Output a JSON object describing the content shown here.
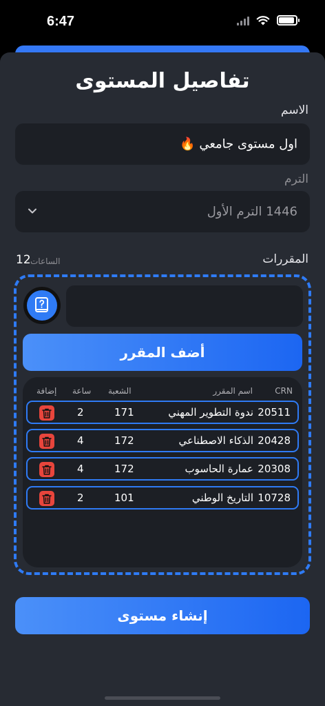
{
  "status": {
    "time": "6:47"
  },
  "title": "تفاصيل المستوى",
  "name_field": {
    "label": "الاسم",
    "value": "اول مستوى جامعي 🔥"
  },
  "term_field": {
    "label": "الترم",
    "value": "1446 الترم الأول"
  },
  "courses": {
    "label": "المقررات",
    "hours_label": "الساعات",
    "hours_value": "12",
    "input_placeholder": "",
    "add_button": "أضف المقرر",
    "columns": {
      "crn": "CRN",
      "name": "اسم المقرر",
      "section": "الشعبة",
      "hours": "ساعة",
      "action": "إضافة"
    },
    "rows": [
      {
        "crn": "20511",
        "name": "ندوة التطوير المهني",
        "section": "171",
        "hours": "2"
      },
      {
        "crn": "20428",
        "name": "الذكاء الاصطناعي",
        "section": "172",
        "hours": "4"
      },
      {
        "crn": "20308",
        "name": "عمارة الحاسوب",
        "section": "172",
        "hours": "4"
      },
      {
        "crn": "10728",
        "name": "التاريخ الوطني",
        "section": "101",
        "hours": "2"
      }
    ]
  },
  "create_button": "إنشاء مستوى",
  "colors": {
    "accent": "#2f7bf5",
    "sheet": "#272b33",
    "field": "#1c1f25",
    "delete": "#e8453c"
  },
  "icons": {
    "course": "book-question-icon",
    "delete": "trash-icon",
    "term_select": "chevron-down-icon"
  }
}
